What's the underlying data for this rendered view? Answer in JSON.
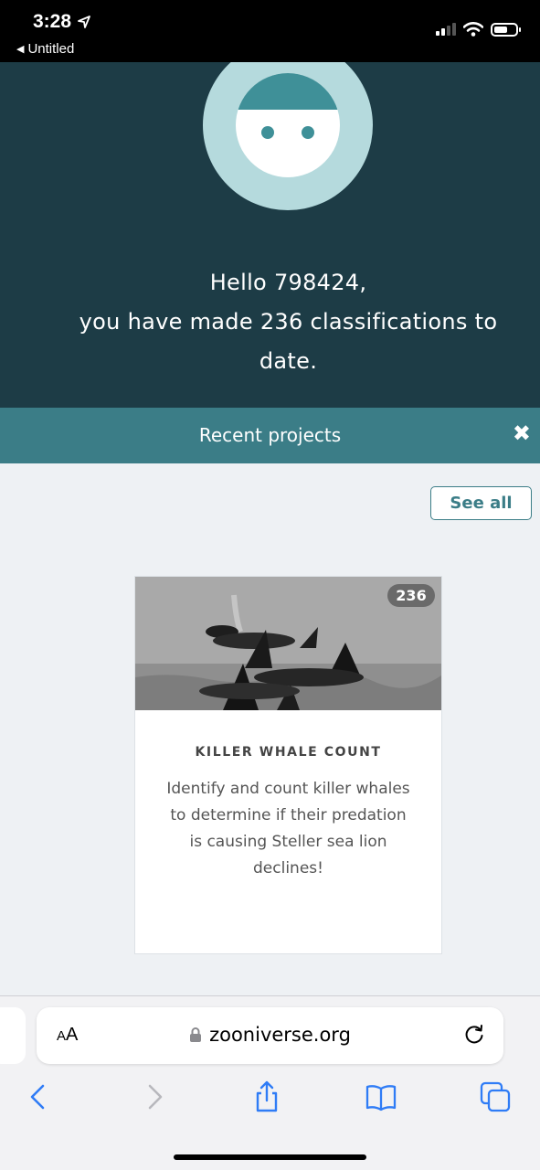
{
  "status_bar": {
    "time": "3:28",
    "back_label": "Untitled"
  },
  "hero": {
    "greeting_line1": "Hello 798424,",
    "greeting_line2": "you have made 236 classifications to date."
  },
  "recent_projects": {
    "title": "Recent projects",
    "close_symbol": "✖",
    "see_all_label": "See all"
  },
  "project_card": {
    "count": "236",
    "title": "KILLER WHALE COUNT",
    "description": "Identify and count killer whales to determine if their predation is causing Steller sea lion declines!"
  },
  "browser": {
    "text_size_label_small": "A",
    "text_size_label_large": "A",
    "url": "zooniverse.org"
  },
  "colors": {
    "hero_bg": "#1d3c46",
    "teal_accent": "#3b7d87",
    "page_bg": "#eef1f4",
    "ios_blue": "#2f7cf6"
  }
}
